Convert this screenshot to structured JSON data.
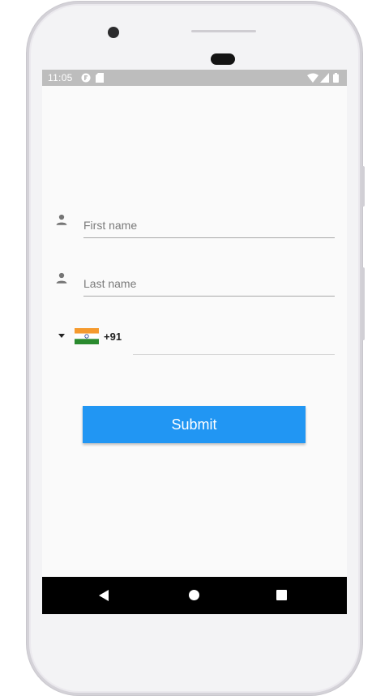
{
  "status_bar": {
    "time": "11:05"
  },
  "form": {
    "first_name": {
      "placeholder": "First name",
      "value": ""
    },
    "last_name": {
      "placeholder": "Last name",
      "value": ""
    },
    "phone": {
      "country_flag": "india-flag-icon",
      "dial_code": "+91",
      "value": ""
    },
    "submit_label": "Submit"
  },
  "colors": {
    "accent": "#2196f3",
    "status_bar": "#bdbdbd",
    "nav_bar": "#000000",
    "screen_bg": "#fafafa"
  },
  "icons": {
    "field_icon": "person-icon",
    "dropdown": "dropdown-arrow-icon",
    "nav_back": "back-triangle-icon",
    "nav_home": "home-circle-icon",
    "nav_recents": "recents-square-icon"
  }
}
